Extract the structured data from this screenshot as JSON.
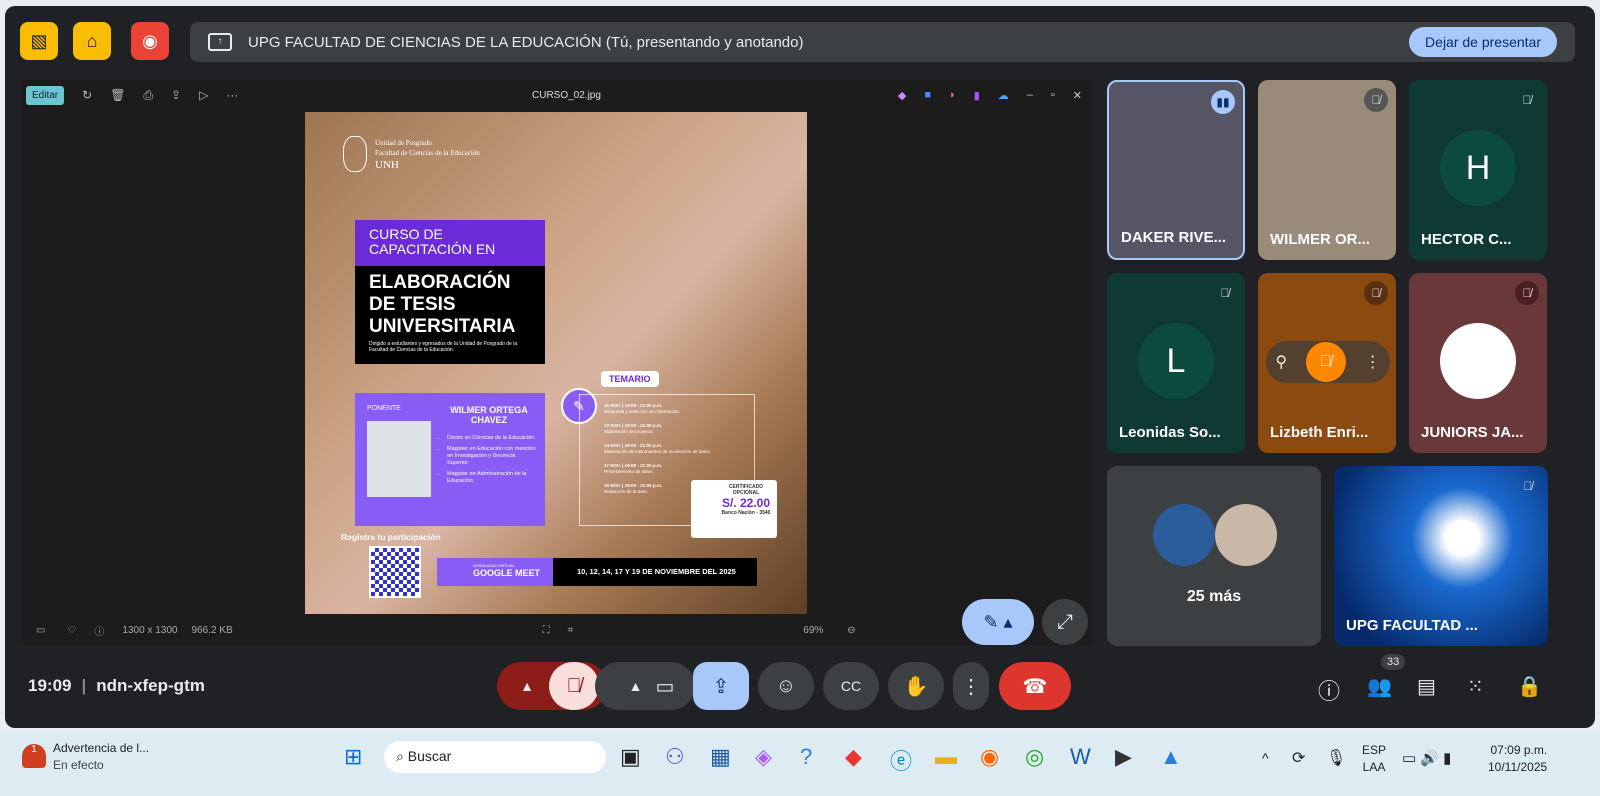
{
  "meet": {
    "banner_title": "UPG FACULTAD DE CIENCIAS DE LA EDUCACIÓN (Tú, presentando y anotando)",
    "stop_presenting": "Dejar de presentar",
    "time": "19:09",
    "meeting_code": "ndn-xfep-gtm",
    "participant_count": "33",
    "more_label": "25 más"
  },
  "viewer": {
    "edit": "Editar",
    "filename": "CURSO_02.jpg",
    "dimensions": "1300 x 1300",
    "filesize": "966.2 KB",
    "zoom": "69%"
  },
  "poster": {
    "org1": "Unidad de Posgrado",
    "org2": "Facultad de Ciencias de la Educación",
    "org3": "UNH",
    "course_pre": "CURSO DE CAPACITACIÓN EN",
    "course_title": "ELABORACIÓN DE TESIS UNIVERSITARIA",
    "audience": "Dirigido a estudiantes y egresados de la Unidad de Posgrado de la Facultad de Ciencias de la Educación.",
    "ponente_label": "PONENTE",
    "ponente_name": "WILMER ORTEGA CHAVEZ",
    "credentials": [
      "Doctor en Ciencias de la Educación.",
      "Magister en Educación con mención en Investigación y Docencia Superior.",
      "Magister en Administración de la Educación."
    ],
    "temario_label": "TEMARIO",
    "temario": [
      {
        "date": "10 NOV. | 19:00 - 21:00 p.m.",
        "topic": "Búsqueda y selección de información."
      },
      {
        "date": "12 NOV. | 19:00 - 21:00 p.m.",
        "topic": "Elaboración de proyecto."
      },
      {
        "date": "14 NOV. | 19:00 - 21:00 p.m.",
        "topic": "Elaboración de instrumentos de recolección de datos."
      },
      {
        "date": "17 NOV. | 19:00 - 21:00 p.m.",
        "topic": "Procesamiento de datos."
      },
      {
        "date": "19 NOV. | 19:00 - 21:00 p.m.",
        "topic": "Redacción de la tesis."
      }
    ],
    "cert_label": "CERTIFICADO OPCIONAL",
    "cert_price": "S/. 22.00",
    "cert_bank": "Banco Nación - 3540",
    "register": "Registra tu participación",
    "modality_label": "MODALIDAD VIRTUAL",
    "modality": "GOOGLE MEET",
    "dates": "10, 12, 14, 17 Y 19 DE NOVIEMBRE DEL 2025"
  },
  "participants": [
    {
      "name": "DAKER RIVE...",
      "initial": ""
    },
    {
      "name": "WILMER OR...",
      "initial": ""
    },
    {
      "name": "HECTOR C...",
      "initial": "H"
    },
    {
      "name": "Leonidas So...",
      "initial": "L"
    },
    {
      "name": "Lizbeth Enri...",
      "initial": ""
    },
    {
      "name": "JUNIORS JA...",
      "initial": ""
    },
    {
      "name": "UPG FACULTAD ...",
      "initial": ""
    }
  ],
  "taskbar": {
    "alert_title": "Advertencia de l...",
    "alert_sub": "En efecto",
    "alert_badge": "1",
    "search": "Buscar",
    "lang1": "ESP",
    "lang2": "LAA",
    "clock": "07:09 p.m.",
    "date": "10/11/2025"
  }
}
